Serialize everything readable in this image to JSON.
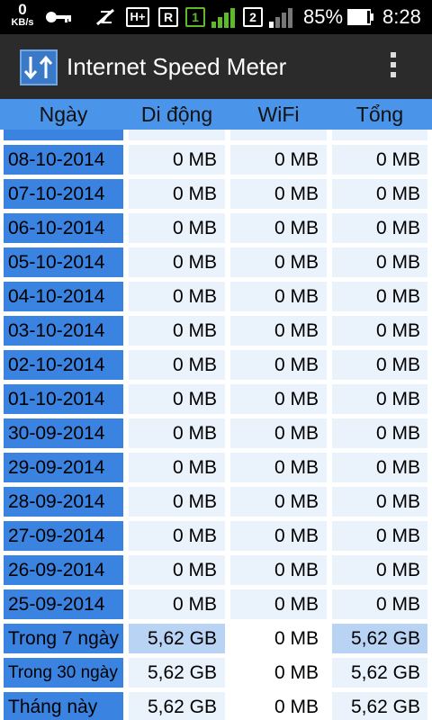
{
  "status": {
    "speed_value": "0",
    "speed_unit": "KB/s",
    "network_type": "H+",
    "roaming": "R",
    "sim1": "1",
    "sim2": "2",
    "battery": "85%",
    "time": "8:28"
  },
  "app": {
    "title": "Internet Speed Meter"
  },
  "table": {
    "headers": {
      "date": "Ngày",
      "mobile": "Di động",
      "wifi": "WiFi",
      "total": "Tổng"
    },
    "rows": [
      {
        "date": "08-10-2014",
        "mobile": "0 MB",
        "wifi": "0 MB",
        "total": "0 MB"
      },
      {
        "date": "07-10-2014",
        "mobile": "0 MB",
        "wifi": "0 MB",
        "total": "0 MB"
      },
      {
        "date": "06-10-2014",
        "mobile": "0 MB",
        "wifi": "0 MB",
        "total": "0 MB"
      },
      {
        "date": "05-10-2014",
        "mobile": "0 MB",
        "wifi": "0 MB",
        "total": "0 MB"
      },
      {
        "date": "04-10-2014",
        "mobile": "0 MB",
        "wifi": "0 MB",
        "total": "0 MB"
      },
      {
        "date": "03-10-2014",
        "mobile": "0 MB",
        "wifi": "0 MB",
        "total": "0 MB"
      },
      {
        "date": "02-10-2014",
        "mobile": "0 MB",
        "wifi": "0 MB",
        "total": "0 MB"
      },
      {
        "date": "01-10-2014",
        "mobile": "0 MB",
        "wifi": "0 MB",
        "total": "0 MB"
      },
      {
        "date": "30-09-2014",
        "mobile": "0 MB",
        "wifi": "0 MB",
        "total": "0 MB"
      },
      {
        "date": "29-09-2014",
        "mobile": "0 MB",
        "wifi": "0 MB",
        "total": "0 MB"
      },
      {
        "date": "28-09-2014",
        "mobile": "0 MB",
        "wifi": "0 MB",
        "total": "0 MB"
      },
      {
        "date": "27-09-2014",
        "mobile": "0 MB",
        "wifi": "0 MB",
        "total": "0 MB"
      },
      {
        "date": "26-09-2014",
        "mobile": "0 MB",
        "wifi": "0 MB",
        "total": "0 MB"
      },
      {
        "date": "25-09-2014",
        "mobile": "0 MB",
        "wifi": "0 MB",
        "total": "0 MB"
      }
    ],
    "summary": [
      {
        "label": "Trong 7 ngày",
        "mobile": "5,62 GB",
        "wifi": "0 MB",
        "total": "5,62 GB"
      },
      {
        "label": "Trong 30 ngày",
        "mobile": "5,62 GB",
        "wifi": "0 MB",
        "total": "5,62 GB"
      },
      {
        "label": "Tháng này",
        "mobile": "5,62 GB",
        "wifi": "0 MB",
        "total": "5,62 GB"
      }
    ]
  },
  "colors": {
    "header_bg": "#4a95ea",
    "date_cell_bg": "#3a83e0",
    "value_cell_bg": "#eaf2fb",
    "highlight_bg": "#b8d3f4",
    "titlebar_bg": "#2b2b2b"
  }
}
